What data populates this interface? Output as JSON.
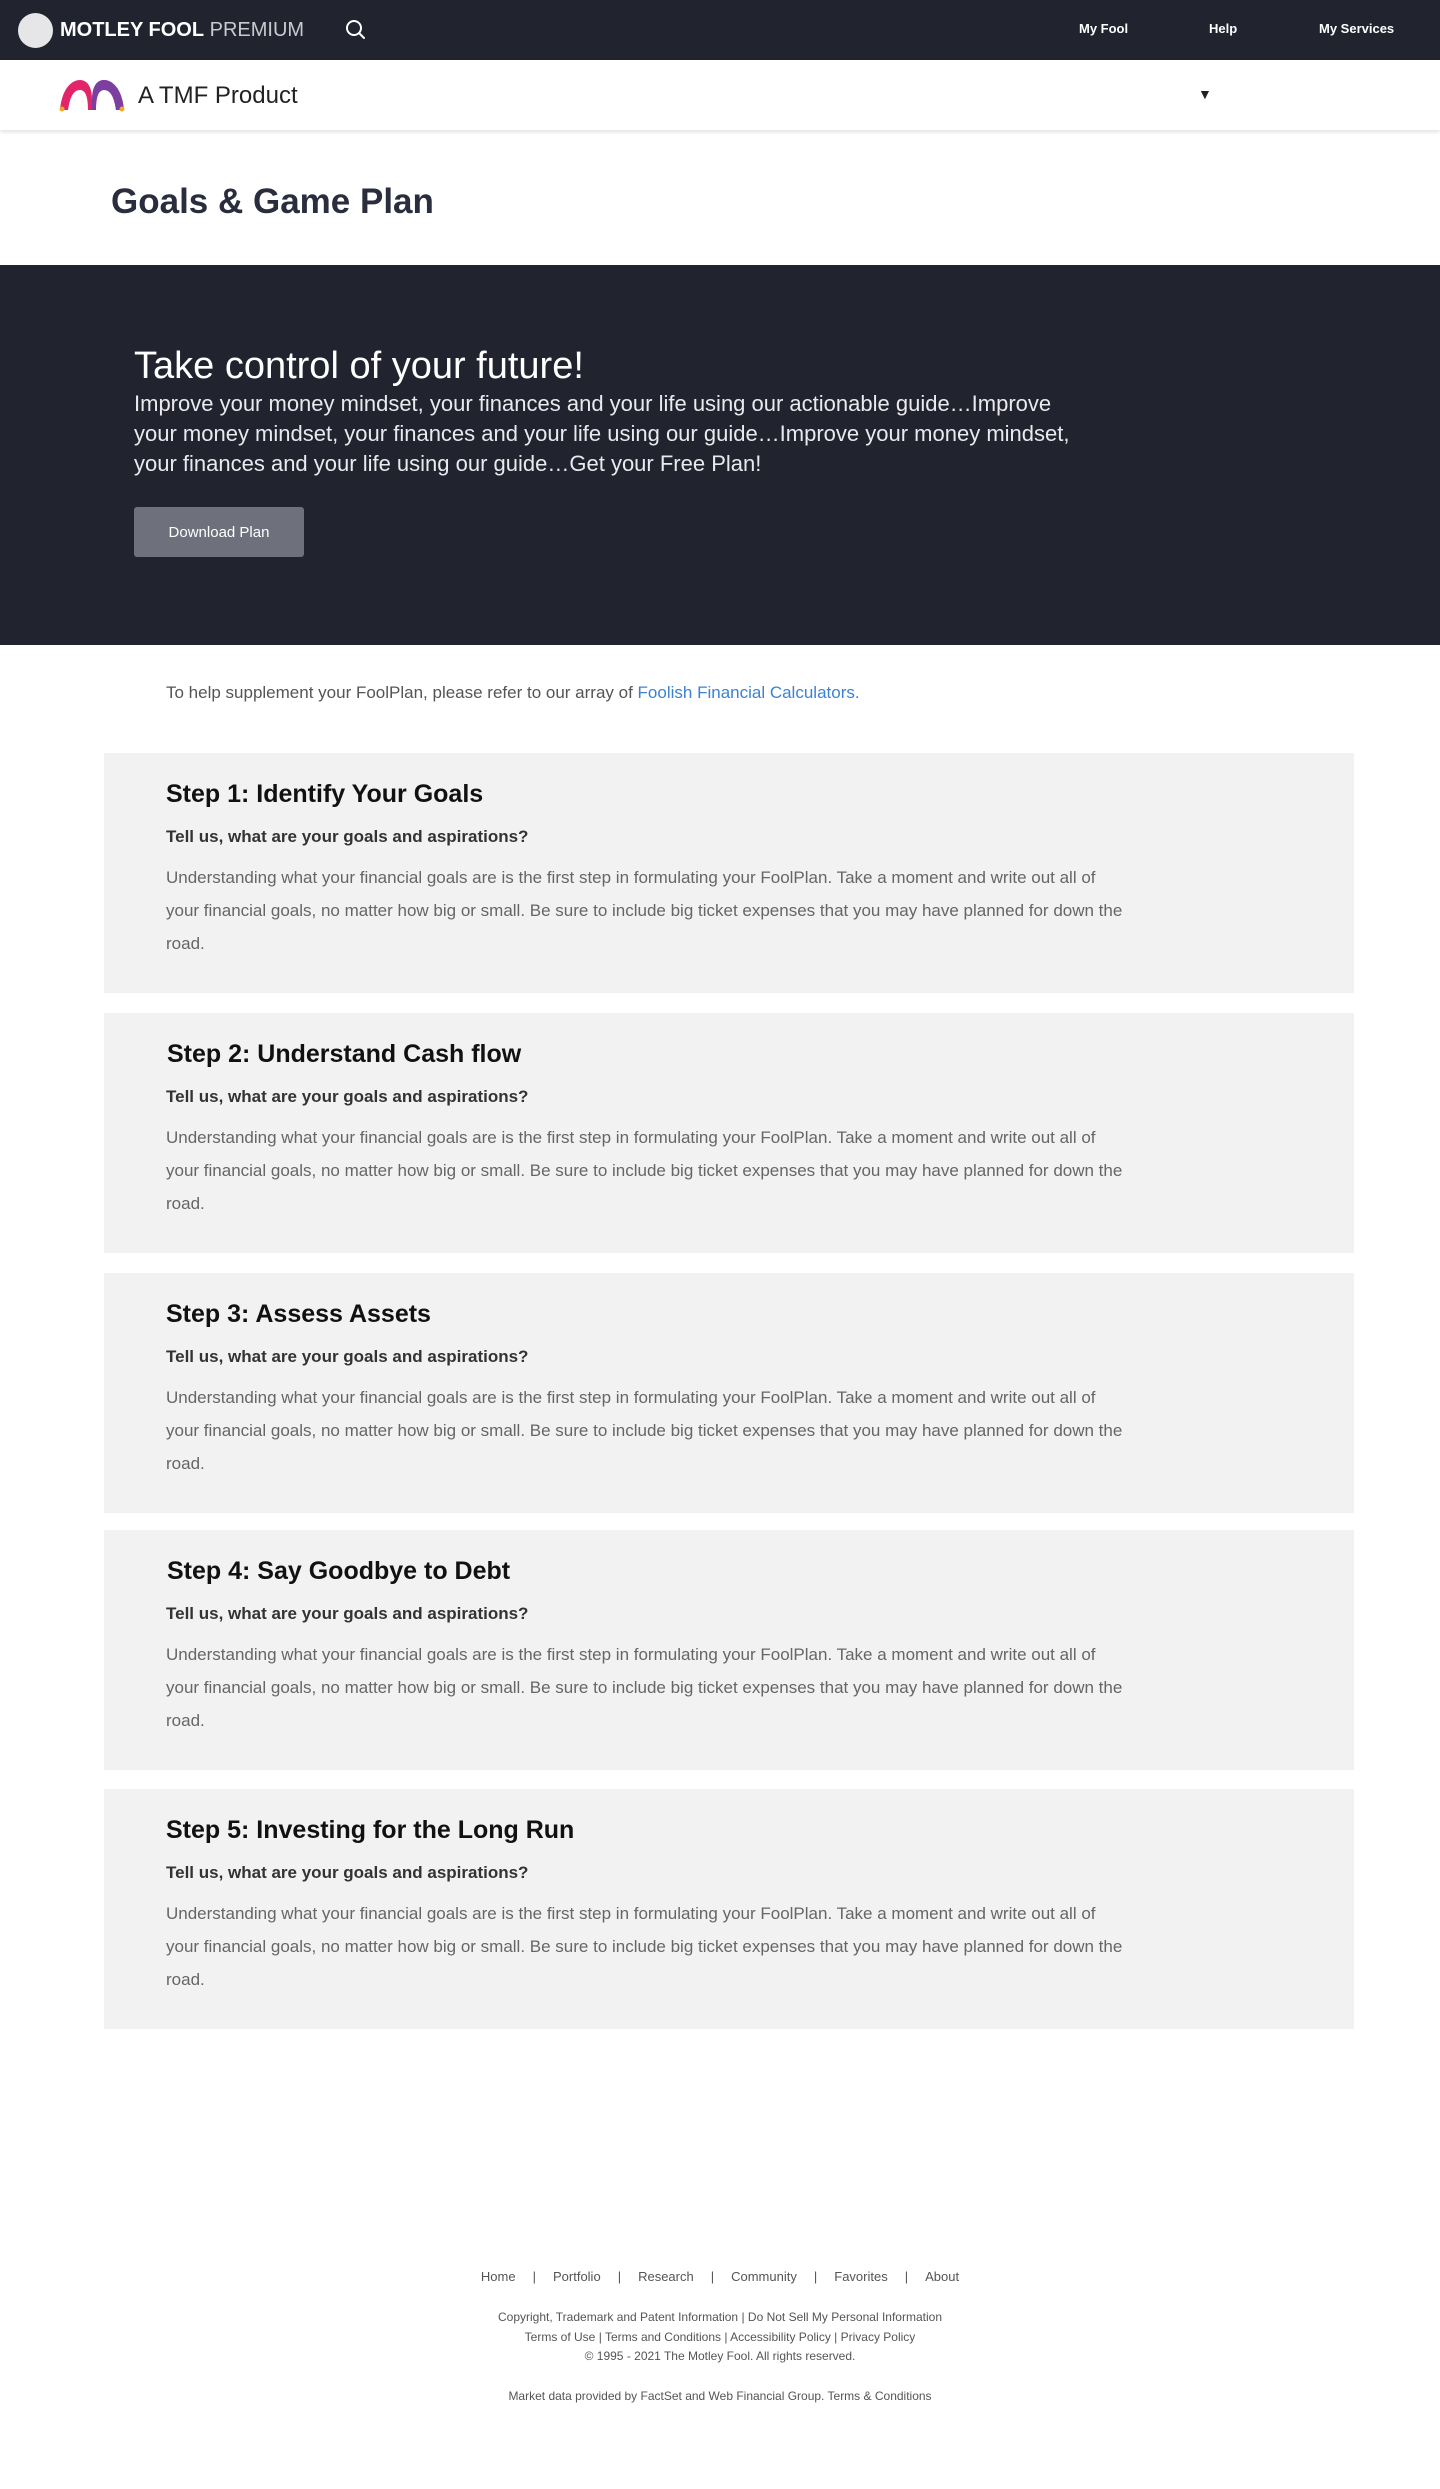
{
  "topnav": {
    "brand_bold": "MOTLEY FOOL",
    "brand_light": "PREMIUM",
    "links": [
      "My Fool",
      "Help",
      "My Services"
    ]
  },
  "product_bar": {
    "name": "A TMF Product",
    "dropdown_caret": "▼"
  },
  "page_title": "Goals & Game Plan",
  "hero": {
    "heading": "Take control of your future!",
    "body": "Improve your money mindset, your finances and your life using our actionable guide…Improve your money mindset, your finances and your life using our guide…Improve your money mindset, your finances and your life using our guide…Get your Free Plan!",
    "button": "Download Plan"
  },
  "intro": {
    "text": "To help supplement your FoolPlan, please refer to our array of ",
    "link": "Foolish Financial Calculators."
  },
  "steps": [
    {
      "title": "Step 1: Identify Your Goals",
      "subtitle": "Tell us, what are your goals and aspirations?",
      "body": "Understanding what your financial goals are is the first step in formulating your FoolPlan. Take a moment and write out all of your financial goals, no matter how big or small. Be sure to include big ticket expenses that you may have planned for down the road."
    },
    {
      "title": "Step 2: Understand Cash flow",
      "subtitle": "Tell us, what are your goals and aspirations?",
      "body": "Understanding what your financial goals are is the first step in formulating your FoolPlan. Take a moment and write out all of your financial goals, no matter how big or small. Be sure to include big ticket expenses that you may have planned for down the road."
    },
    {
      "title": "Step 3: Assess Assets",
      "subtitle": "Tell us, what are your goals and aspirations?",
      "body": "Understanding what your financial goals are is the first step in formulating your FoolPlan. Take a moment and write out all of your financial goals, no matter how big or small. Be sure to include big ticket expenses that you may have planned for down the road."
    },
    {
      "title": "Step 4: Say Goodbye to Debt",
      "subtitle": "Tell us, what are your goals and aspirations?",
      "body": "Understanding what your financial goals are is the first step in formulating your FoolPlan. Take a moment and write out all of your financial goals, no matter how big or small. Be sure to include big ticket expenses that you may have planned for down the road."
    },
    {
      "title": "Step 5: Investing for the Long Run",
      "subtitle": "Tell us, what are your goals and aspirations?",
      "body": "Understanding what your financial goals are is the first step in formulating your FoolPlan. Take a moment and write out all of your financial goals, no matter how big or small. Be sure to include big ticket expenses that you may have planned for down the road."
    }
  ],
  "footer": {
    "links": [
      "Home",
      "Portfolio",
      "Research",
      "Community",
      "Favorites",
      "About"
    ],
    "separator": "|",
    "legal_line1": [
      "Copyright, Trademark and Patent Information",
      "Do Not Sell My Personal Information"
    ],
    "legal_line2": [
      "Terms of Use",
      "Terms and Conditions",
      "Accessibility Policy",
      "Privacy Policy"
    ],
    "copyright": "© 1995 - 2021 The Motley Fool. All rights reserved.",
    "market_data_text": "Market data provided by FactSet and Web Financial Group.",
    "market_data_link": "Terms & Conditions"
  },
  "colors": {
    "nav_bg": "#21232f",
    "hero_bg": "#21232f",
    "button_bg": "#6e707c",
    "link": "#3c82d3",
    "step_bg": "#f2f2f2",
    "jester_pink": "#e2256a",
    "jester_purple": "#7b3fa0"
  },
  "icons": {
    "search": "search-icon",
    "logo": "motley-fool-logo-icon",
    "jester": "jester-cap-icon"
  }
}
